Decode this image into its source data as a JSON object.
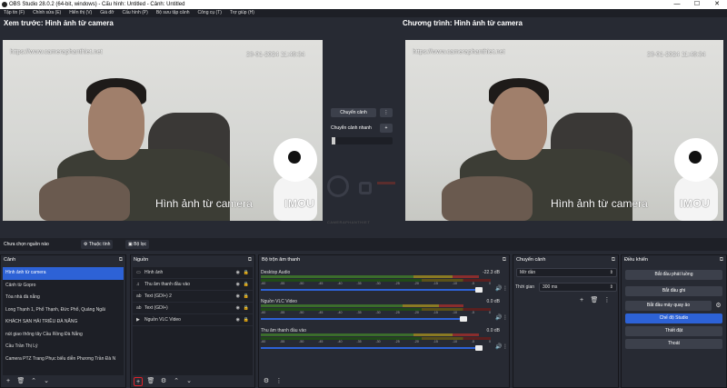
{
  "window": {
    "title": "OBS Studio 28.0.2 (64-bit, windows) - Cấu hình: Untitled - Cảnh: Untitled",
    "min": "—",
    "max": "☐",
    "close": "✕"
  },
  "menu": [
    "Tập tin (F)",
    "Chỉnh sửa (E)",
    "Hiển thị (V)",
    "Giá đỡ",
    "Cấu hình (P)",
    "Bộ sưu tập cảnh",
    "Công cụ (T)",
    "Trợ giúp (H)"
  ],
  "preview": {
    "label": "Xem trước: Hình ảnh từ camera",
    "url": "https://www.cameraphanthiet.net",
    "timestamp": "23-01-2024 11:49:34",
    "caption": "Hình ảnh từ camera",
    "brand": "IMOU"
  },
  "program": {
    "label": "Chương trình: Hình ảnh từ camera",
    "url": "https://www.cameraphanthiet.net",
    "timestamp": "23-01-2024 11:49:34",
    "caption": "Hình ảnh từ camera",
    "brand": "IMOU"
  },
  "transition_mid": {
    "button": "Chuyển cảnh",
    "quick_label": "Chuyển cảnh nhanh",
    "dots": "⋮",
    "plus": "+"
  },
  "watermark": "CAMERAPHANTHIET",
  "context": {
    "no_source": "Chưa chọn nguồn nào",
    "properties": "Thuộc tính",
    "filters": "Bộ lọc"
  },
  "scenes": {
    "title": "Cảnh",
    "items": [
      "Hình ảnh từ camera",
      "Cảnh từ Gopro",
      "Tòa nhà đà nẵng",
      "Long Thạnh 1, Phổ Thạnh, Đức Phổ, Quảng Ngãi",
      "KHÁCH SẠN HẢI TRIỀU ĐÀ NẴNG",
      "nút giao thông tây Cầu Rồng Đà Nẵng",
      "Cầu Trần Thị Lý",
      "Camera PTZ Trang Phục biểu diễn Phương Trần Đà N"
    ]
  },
  "sources": {
    "title": "Nguồn",
    "items": [
      {
        "icon": "▭",
        "label": "Hình ảnh"
      },
      {
        "icon": "♫",
        "label": "Thu âm thanh đầu vào"
      },
      {
        "icon": "ab",
        "label": "Text (GDI+) 2"
      },
      {
        "icon": "ab",
        "label": "Text (GDI+)"
      },
      {
        "icon": "▶",
        "label": "Nguồn VLC Video"
      }
    ]
  },
  "mixer": {
    "title": "Bộ trộn âm thanh",
    "ticks": [
      "-60",
      "-55",
      "-50",
      "-45",
      "-40",
      "-35",
      "-30",
      "-25",
      "-20",
      "-15",
      "-10",
      "-5",
      "0"
    ],
    "channels": [
      {
        "name": "Desktop Audio",
        "db": "-22.3 dB",
        "level": 0.95
      },
      {
        "name": "Nguồn VLC Video",
        "db": "0.0 dB",
        "level": 0.88
      },
      {
        "name": "Thu âm thanh đầu vào",
        "db": "0.0 dB",
        "level": 0.95
      }
    ]
  },
  "transitions": {
    "title": "Chuyển cảnh",
    "type": "Mờ dần",
    "duration_label": "Thời gian",
    "duration": "300 ms"
  },
  "controls": {
    "title": "Điều khiển",
    "buttons": [
      "Bắt đầu phát luồng",
      "Bắt đầu ghi",
      "Bắt đầu máy quay ảo",
      "Chế độ Studio",
      "Thiết đặt",
      "Thoát"
    ]
  },
  "colors": {
    "accent": "#2d62d6",
    "bg": "#272a33",
    "highlight": "#e0222a"
  }
}
